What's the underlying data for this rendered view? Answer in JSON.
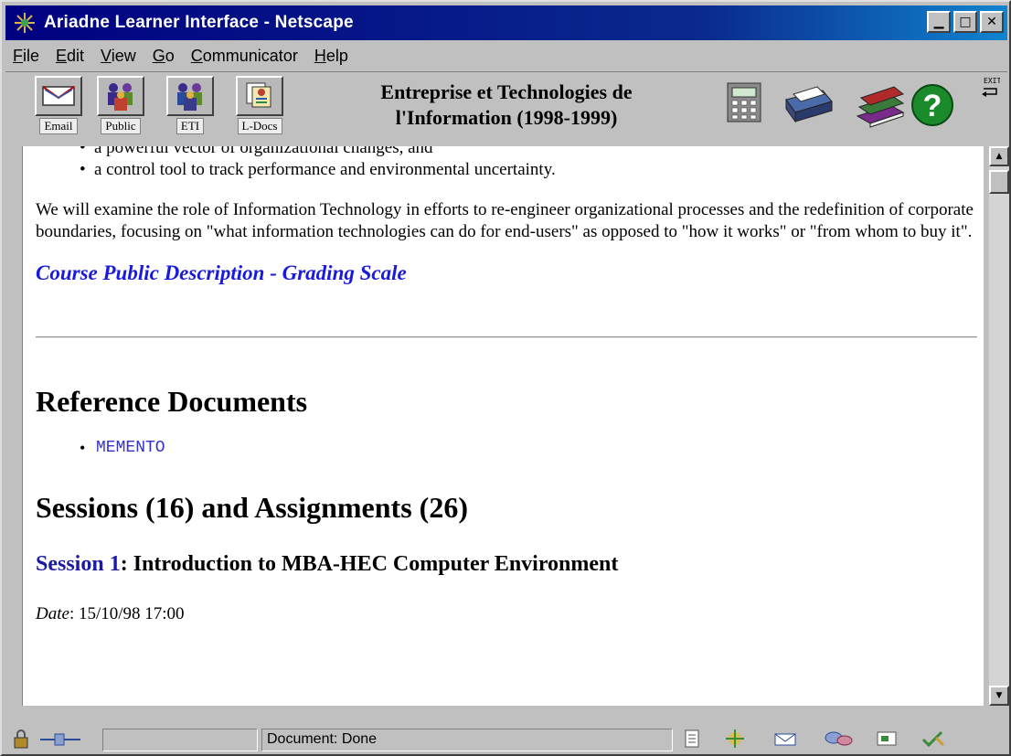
{
  "window": {
    "title": "Ariadne Learner Interface - Netscape",
    "buttons": [
      "minimize",
      "maximize",
      "close"
    ]
  },
  "menu": {
    "items": [
      "File",
      "Edit",
      "View",
      "Go",
      "Communicator",
      "Help"
    ],
    "accelerators": [
      "F",
      "E",
      "V",
      "G",
      "C",
      "H"
    ]
  },
  "toolbar": {
    "buttons": [
      {
        "label": "Email",
        "icon": "email-icon"
      },
      {
        "label": "Public",
        "icon": "people-icon"
      },
      {
        "label": "ETI",
        "icon": "people-icon"
      },
      {
        "label": "L-Docs",
        "icon": "documents-icon"
      }
    ],
    "course_title_line1": "Entreprise et Technologies de",
    "course_title_line2": "l'Information (1998-1999)",
    "right_icons": [
      "calculator-icon",
      "printer-icon",
      "books-icon",
      "help-icon"
    ],
    "exit_label": "EXIT"
  },
  "content": {
    "bullets": [
      "a powerful vector of organizational changes, and",
      "a control tool to track performance and environmental uncertainty."
    ],
    "paragraph": "We will examine the role of Information Technology in efforts to re-engineer organizational processes and the redefinition of corporate boundaries, focusing on \"what information technologies can do for end-users\" as opposed to \"how it works\" or \"from whom to buy it\".",
    "course_link": "Course Public Description - Grading Scale",
    "reference_heading": "Reference Documents",
    "reference_items": [
      "MEMENTO"
    ],
    "sessions_heading": "Sessions (16) and Assignments (26)",
    "session1_link": "Session 1",
    "session1_title": ": Introduction to MBA-HEC Computer Environment",
    "date_label": "Date",
    "date_value": ": 15/10/98 17:00"
  },
  "status": {
    "text": "Document: Done"
  },
  "colors": {
    "titlebar": "#000080",
    "link": "#1a1adf",
    "visited_link": "#3333cc",
    "chrome": "#c0c0c0"
  }
}
